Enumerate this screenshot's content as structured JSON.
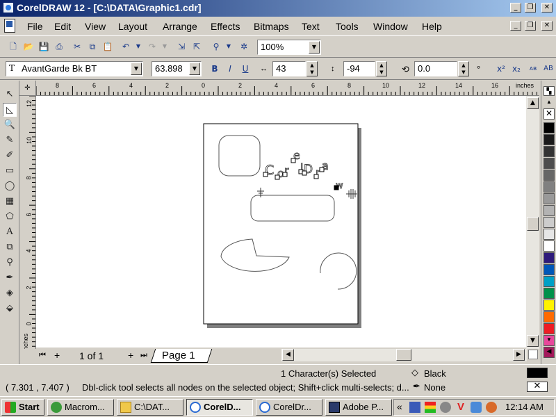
{
  "window": {
    "title": "CorelDRAW 12 - [C:\\DATA\\Graphic1.cdr]",
    "minimize": "_",
    "restore": "❐",
    "close": "✕"
  },
  "menu": [
    "File",
    "Edit",
    "View",
    "Layout",
    "Arrange",
    "Effects",
    "Bitmaps",
    "Text",
    "Tools",
    "Window",
    "Help"
  ],
  "standard_toolbar": {
    "zoom": "100%"
  },
  "property_bar": {
    "font_name": "AvantGarde Bk BT",
    "font_size": "63.898",
    "bold": "B",
    "italic": "I",
    "underline": "U",
    "horizontal_shift": "43",
    "vertical_shift": "-94",
    "rotation": "0.0",
    "rotation_unit": "°",
    "superscript": "x²",
    "subscript": "x₂",
    "small_caps": "ᴀʙ",
    "all_caps": "AB"
  },
  "rulers": {
    "unit": "inches",
    "horizontal_labels": [
      "8",
      "6",
      "4",
      "2",
      "0",
      "2",
      "4",
      "6",
      "8",
      "10",
      "12",
      "14",
      "16"
    ],
    "vertical_labels": [
      "12",
      "10",
      "8",
      "6",
      "4",
      "2",
      "0"
    ],
    "vertical_unit": "inches"
  },
  "document": {
    "text_chars": [
      "C",
      "o",
      "r",
      "e",
      "l",
      "D",
      "r",
      "a",
      "w"
    ]
  },
  "page_nav": {
    "first": "⏮",
    "add_before": "+",
    "counter": "1 of 1",
    "add_after": "+",
    "last": "⏭",
    "tab_label": "Page 1"
  },
  "status": {
    "selection": "1 Character(s) Selected",
    "fill_label": "Black",
    "outline_label": "None",
    "coordinates": "( 7.301 , 7.407 )",
    "hint": "Dbl-click tool selects all nodes on the selected object; Shift+click multi-selects; d..."
  },
  "palette": {
    "colors": [
      "#000000",
      "#1a1a1a",
      "#333333",
      "#4d4d4d",
      "#666666",
      "#808080",
      "#999999",
      "#b3b3b3",
      "#cccccc",
      "#e6e6e6",
      "#ffffff",
      "#2e1a7a",
      "#0057b8",
      "#00a0c6",
      "#00904a",
      "#fff200",
      "#ff6a00",
      "#ed1c24",
      "#e8479b",
      "#a3195b"
    ]
  },
  "taskbar": {
    "start": "Start",
    "tasks": [
      "Macrom...",
      "C:\\DAT...",
      "CorelD...",
      "CorelDr...",
      "Adobe P..."
    ],
    "tray_expand": "«",
    "clock": "12:14 AM"
  },
  "fill_swatch": "#000000"
}
